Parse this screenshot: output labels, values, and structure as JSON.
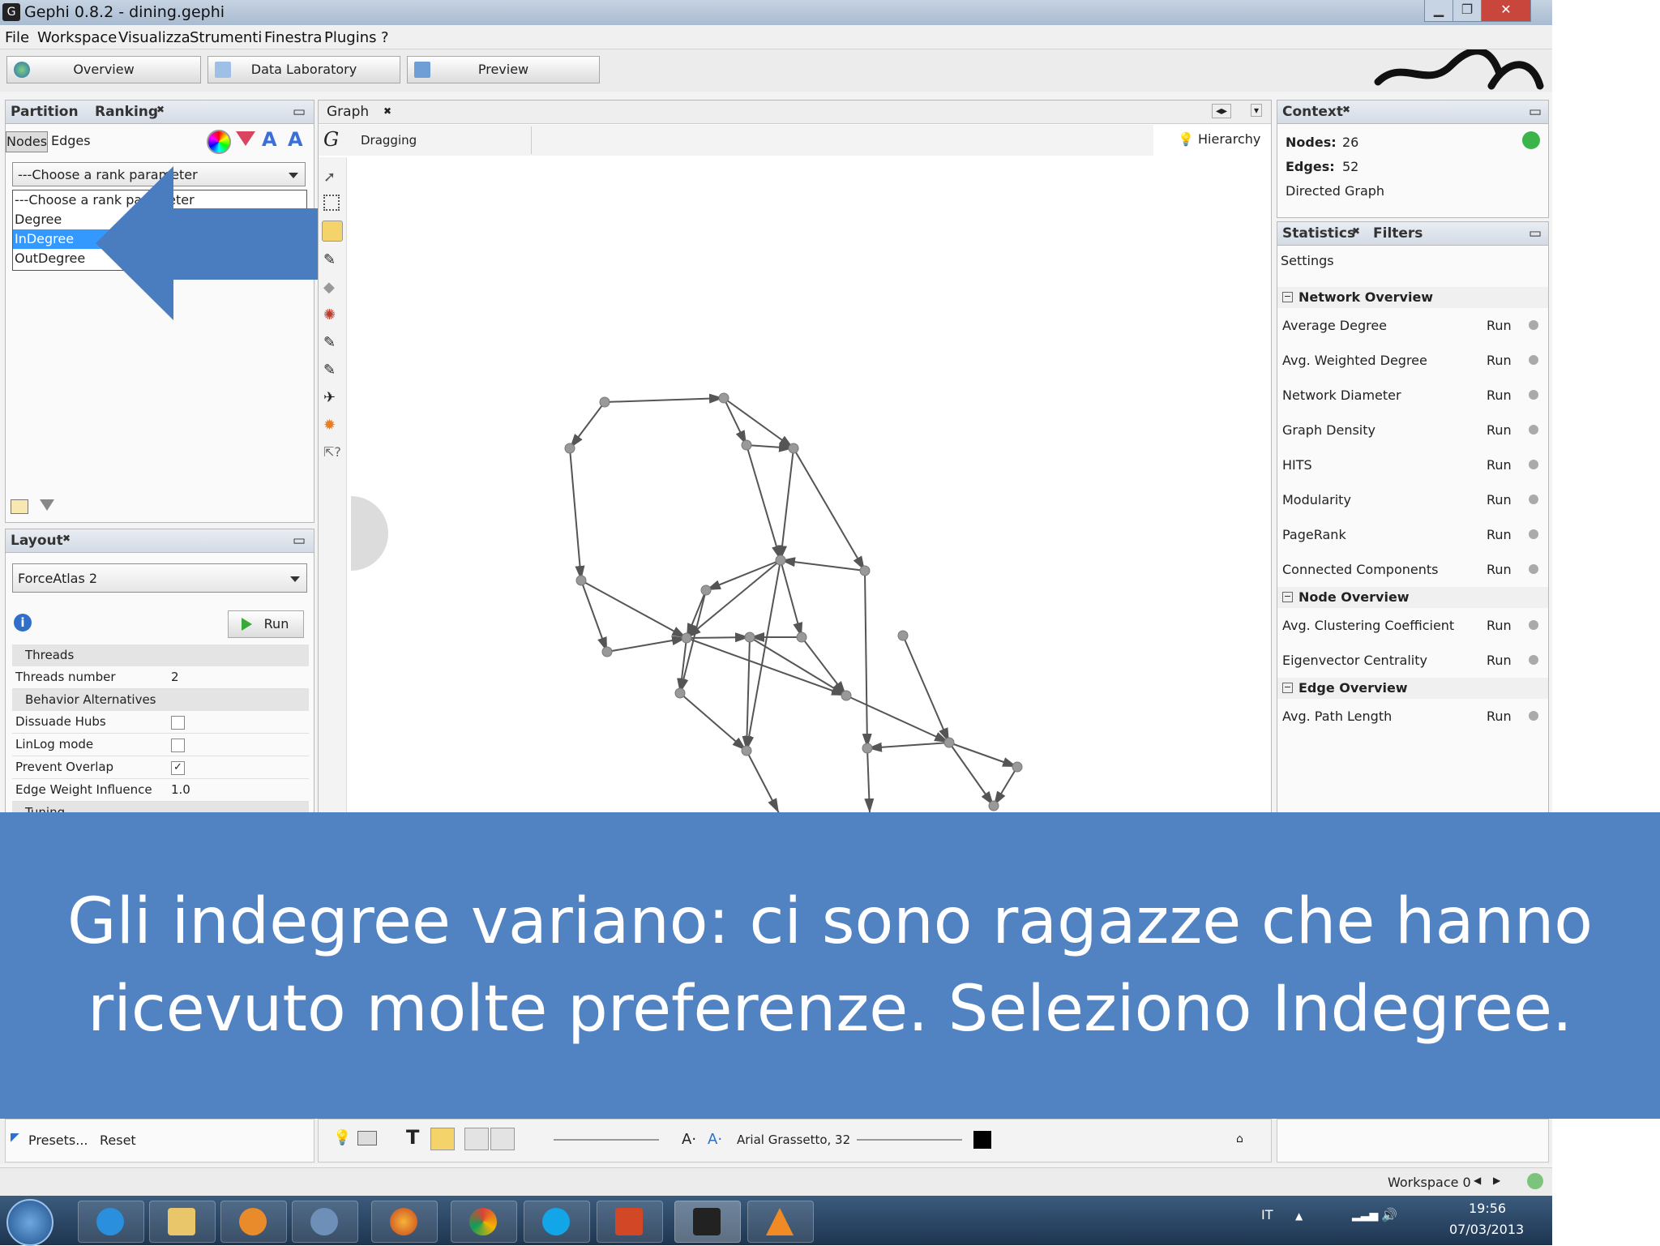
{
  "window": {
    "title": "Gephi 0.8.2 - dining.gephi",
    "app_icon": "gephi-icon"
  },
  "menu": [
    "File",
    "Workspace",
    "Visualizza",
    "Strumenti",
    "Finestra",
    "Plugins",
    "?"
  ],
  "toolbar": {
    "overview": "Overview",
    "data_lab": "Data Laboratory",
    "preview": "Preview"
  },
  "ranking": {
    "tabs": [
      "Partition",
      "Ranking"
    ],
    "sub_tabs": [
      "Nodes",
      "Edges"
    ],
    "dropdown_value": "---Choose a rank parameter",
    "list": [
      "---Choose a rank parameter",
      "Degree",
      "InDegree",
      "OutDegree"
    ],
    "selected": "InDegree"
  },
  "layout": {
    "tab": "Layout",
    "algorithm": "ForceAtlas 2",
    "run": "Run",
    "props": {
      "threads": "Threads",
      "threads_number": "Threads number",
      "threads_number_value": "2",
      "behavior": "Behavior Alternatives",
      "dissuade": "Dissuade Hubs",
      "linlog": "LinLog mode",
      "prevent_overlap": "Prevent Overlap",
      "edge_weight": "Edge Weight Influence",
      "edge_weight_value": "1.0",
      "tuning": "Tuning"
    }
  },
  "graph": {
    "tab": "Graph",
    "mode": "Dragging",
    "hierarchy": "Hierarchy"
  },
  "context": {
    "tab": "Context",
    "nodes_label": "Nodes:",
    "nodes_value": "26",
    "edges_label": "Edges:",
    "edges_value": "52",
    "type": "Directed Graph"
  },
  "statistics": {
    "tabs": [
      "Statistics",
      "Filters"
    ],
    "settings": "Settings",
    "run_label": "Run",
    "network_overview": "Network Overview",
    "network_items": [
      "Average Degree",
      "Avg. Weighted Degree",
      "Network Diameter",
      "Graph Density",
      "HITS",
      "Modularity",
      "PageRank",
      "Connected Components"
    ],
    "node_overview": "Node Overview",
    "node_items": [
      "Avg. Clustering Coefficient",
      "Eigenvector Centrality"
    ],
    "edge_overview": "Edge Overview",
    "edge_items": [
      "Avg. Path Length"
    ]
  },
  "bottom": {
    "presets": "Presets...",
    "reset": "Reset",
    "font": "Arial Grassetto, 32",
    "workspace": "Workspace 0"
  },
  "banner": {
    "line1": "Gli indegree variano: ci sono ragazze che hanno",
    "line2": "ricevuto molte preferenze. Seleziono Indegree."
  },
  "taskbar": {
    "lang": "IT",
    "time": "19:56",
    "date": "07/03/2013"
  },
  "colors": {
    "banner": "#5182c2",
    "arrow": "#4a7cc0",
    "selection": "#3399ff"
  }
}
